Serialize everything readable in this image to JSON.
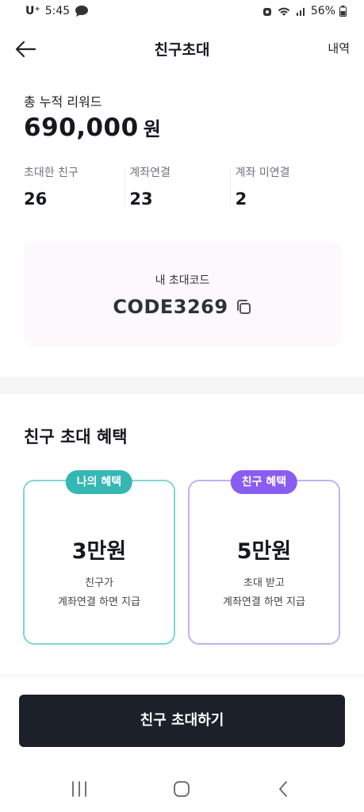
{
  "status_bar": {
    "carrier": "U⁺",
    "time": "5:45",
    "battery": "56%"
  },
  "header": {
    "title": "친구초대",
    "history_label": "내역"
  },
  "reward": {
    "label": "총 누적 리워드",
    "amount": "690,000",
    "unit": "원"
  },
  "stats": [
    {
      "label": "초대한 친구",
      "value": "26"
    },
    {
      "label": "계좌연결",
      "value": "23"
    },
    {
      "label": "계좌 미연결",
      "value": "2"
    }
  ],
  "invite_code": {
    "label": "내 초대코드",
    "code": "CODE3269"
  },
  "benefits": {
    "title": "친구 초대 혜택",
    "mine": {
      "badge": "나의 혜택",
      "amount": "3만원",
      "desc_line1": "친구가",
      "desc_line2": "계좌연결 하면 지급"
    },
    "friend": {
      "badge": "친구 혜택",
      "amount": "5만원",
      "desc_line1": "초대 받고",
      "desc_line2": "계좌연결 하면 지급"
    }
  },
  "cta": {
    "label": "친구 초대하기"
  },
  "colors": {
    "mine_accent": "#35b7b4",
    "friend_accent": "#8a5df0",
    "cta_background": "#1b2029"
  },
  "icons": {
    "back": "arrow-left-icon",
    "copy": "copy-icon",
    "nav_recent": "recent-apps-icon",
    "nav_home": "home-icon",
    "nav_back": "chevron-left-icon"
  }
}
